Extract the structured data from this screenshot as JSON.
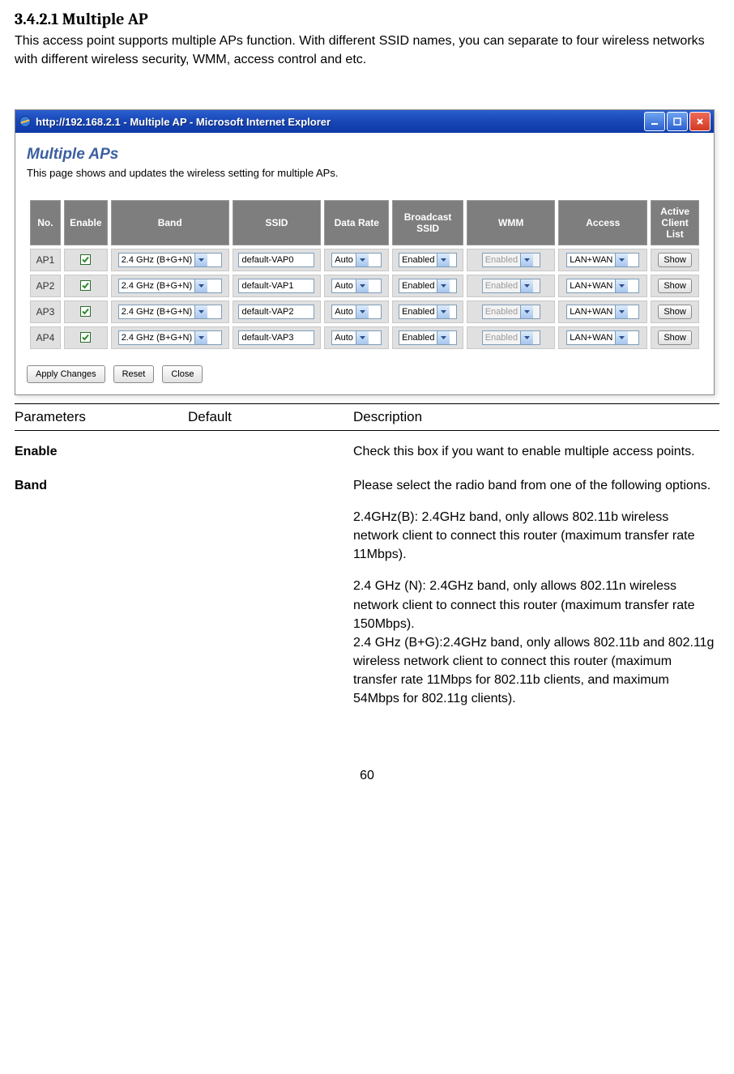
{
  "heading": "3.4.2.1 Multiple AP",
  "intro": "This access point supports multiple APs function. With different SSID names, you can separate to four wireless networks with different wireless security, WMM, access control and etc.",
  "browser": {
    "title": "http://192.168.2.1 - Multiple AP - Microsoft Internet Explorer",
    "page_title": "Multiple APs",
    "page_desc": "This page shows and updates the wireless setting for multiple APs.",
    "headers": [
      "No.",
      "Enable",
      "Band",
      "SSID",
      "Data Rate",
      "Broadcast SSID",
      "WMM",
      "Access",
      "Active Client List"
    ],
    "rows": [
      {
        "no": "AP1",
        "enable": true,
        "band": "2.4 GHz (B+G+N)",
        "ssid": "default-VAP0",
        "rate": "Auto",
        "bcast": "Enabled",
        "wmm": "Enabled",
        "access": "LAN+WAN",
        "show": "Show"
      },
      {
        "no": "AP2",
        "enable": true,
        "band": "2.4 GHz (B+G+N)",
        "ssid": "default-VAP1",
        "rate": "Auto",
        "bcast": "Enabled",
        "wmm": "Enabled",
        "access": "LAN+WAN",
        "show": "Show"
      },
      {
        "no": "AP3",
        "enable": true,
        "band": "2.4 GHz (B+G+N)",
        "ssid": "default-VAP2",
        "rate": "Auto",
        "bcast": "Enabled",
        "wmm": "Enabled",
        "access": "LAN+WAN",
        "show": "Show"
      },
      {
        "no": "AP4",
        "enable": true,
        "band": "2.4 GHz (B+G+N)",
        "ssid": "default-VAP3",
        "rate": "Auto",
        "bcast": "Enabled",
        "wmm": "Enabled",
        "access": "LAN+WAN",
        "show": "Show"
      }
    ],
    "buttons": {
      "apply": "Apply Changes",
      "reset": "Reset",
      "close": "Close"
    }
  },
  "param_headers": {
    "p": "Parameters",
    "d": "Default",
    "desc": "Description"
  },
  "params": [
    {
      "name": "Enable",
      "default": "",
      "desc": [
        "Check this box if you want to enable multiple access points."
      ]
    },
    {
      "name": "Band",
      "default": "",
      "desc": [
        "Please select the radio band from one of the following options.",
        "2.4GHz(B): 2.4GHz band, only allows 802.11b wireless network client to connect this router (maximum transfer rate 11Mbps).",
        "2.4 GHz (N): 2.4GHz band, only allows 802.11n wireless network client to connect this router (maximum transfer rate 150Mbps).\n2.4 GHz (B+G):2.4GHz band, only allows 802.11b and 802.11g wireless network client to connect this router (maximum transfer rate 11Mbps for 802.11b clients, and maximum 54Mbps for 802.11g clients)."
      ]
    }
  ],
  "page_number": "60"
}
